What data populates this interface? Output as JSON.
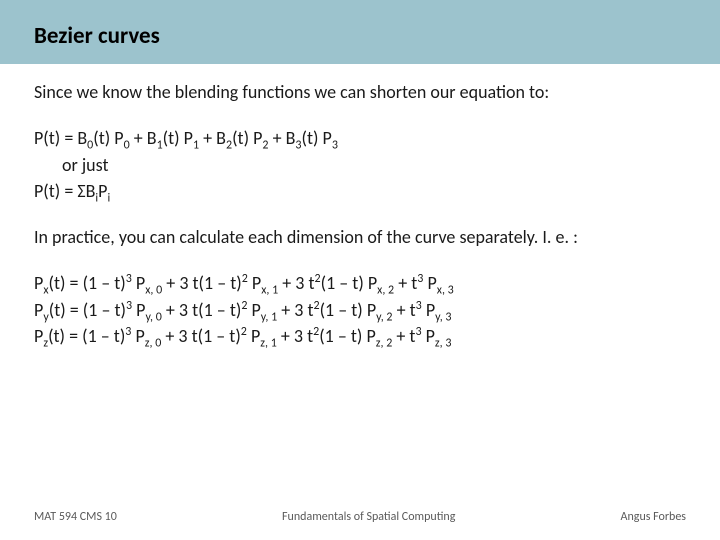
{
  "slide": {
    "title": "Bezier curves",
    "intro": "Since we know the blending functions we can shorten our equation to:",
    "eq1": {
      "line1_pre": "P(t) = B",
      "line1_s0": "0",
      "line1_a": "(t) P",
      "line1_s1": "0",
      "line1_b": " + B",
      "line1_s2": "1",
      "line1_c": "(t) P",
      "line1_s3": "1",
      "line1_d": " + B",
      "line1_s4": "2",
      "line1_e": "(t) P",
      "line1_s5": "2",
      "line1_f": " + B",
      "line1_s6": "3",
      "line1_g": "(t) P",
      "line1_s7": "3",
      "line2": "or just",
      "line3_pre": "P(t) = ΣB",
      "line3_s0": "i",
      "line3_a": "P",
      "line3_s1": "i"
    },
    "practice": "In practice, you can calculate each dimension of the curve separately. I. e. :",
    "eq2": {
      "rows": [
        {
          "axis": "x"
        },
        {
          "axis": "y"
        },
        {
          "axis": "z"
        }
      ],
      "tpl": {
        "a": "(t) = (1 – t)",
        "p3": "3",
        "b": " P",
        "c": " + 3 t(1 – t)",
        "p2": "2",
        "d": " P",
        "e": " + 3 t",
        "f": "(1 – t) P",
        "g": " + t",
        "h": " P"
      }
    },
    "footer": {
      "left": "MAT 594 CMS 10",
      "center": "Fundamentals of Spatial Computing",
      "right": "Angus Forbes"
    }
  }
}
